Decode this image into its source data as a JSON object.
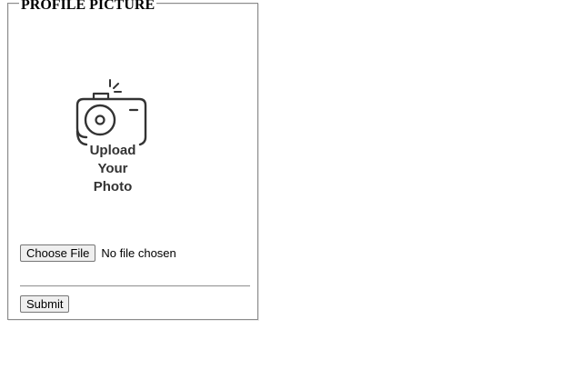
{
  "form": {
    "legend": "PROFILE PICTURE",
    "illustration": {
      "icon": "camera-icon",
      "lines": [
        "Upload",
        "Your",
        "Photo"
      ]
    },
    "file_input": {
      "button_label": "Choose File",
      "status_text": "No file chosen"
    },
    "submit_label": "Submit"
  }
}
